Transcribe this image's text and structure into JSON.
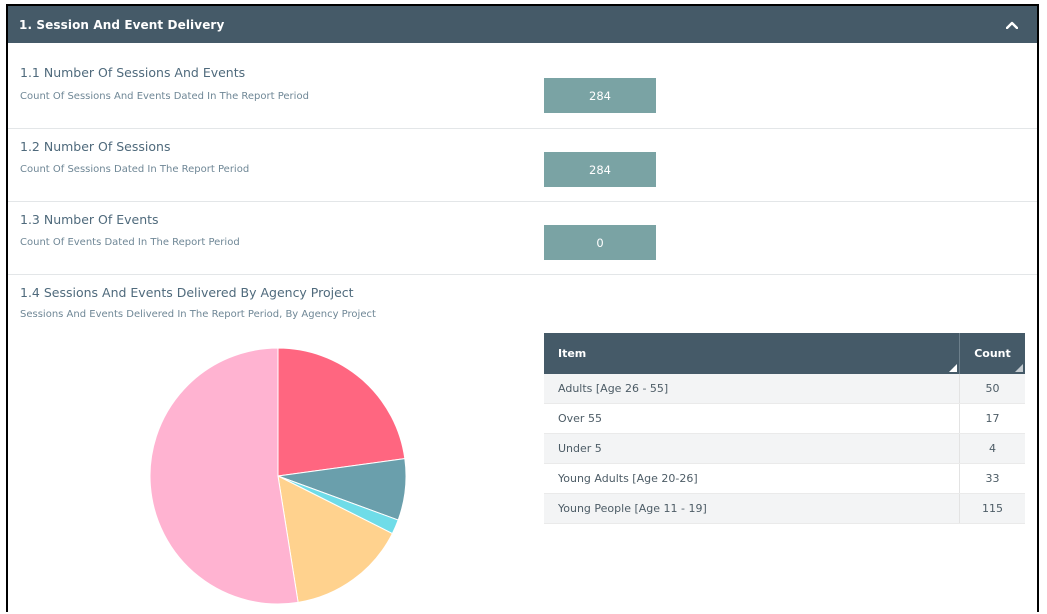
{
  "header": {
    "title": "1. Session And Event Delivery",
    "collapse_icon": "chevron-up-icon"
  },
  "sections": [
    {
      "title": "1.1 Number Of Sessions And Events",
      "subtitle": "Count Of Sessions And Events Dated In The Report Period",
      "value": "284"
    },
    {
      "title": "1.2 Number Of Sessions",
      "subtitle": "Count Of Sessions Dated In The Report Period",
      "value": "284"
    },
    {
      "title": "1.3 Number Of Events",
      "subtitle": "Count Of Events Dated In The Report Period",
      "value": "0"
    }
  ],
  "breakdown": {
    "title": "1.4 Sessions And Events Delivered By Agency Project",
    "subtitle": "Sessions And Events Delivered In The Report Period, By Agency Project",
    "table": {
      "headers": [
        "Item",
        "Count"
      ],
      "rows": [
        {
          "item": "Adults [Age 26 - 55]",
          "count": "50"
        },
        {
          "item": "Over 55",
          "count": "17"
        },
        {
          "item": "Under 5",
          "count": "4"
        },
        {
          "item": "Young Adults [Age 20-26]",
          "count": "33"
        },
        {
          "item": "Young People [Age 11 - 19]",
          "count": "115"
        }
      ]
    }
  },
  "chart_data": {
    "type": "pie",
    "categories": [
      "Adults [Age 26 - 55]",
      "Over 55",
      "Under 5",
      "Young Adults [Age 20-26]",
      "Young People [Age 11 - 19]"
    ],
    "values": [
      50,
      17,
      4,
      33,
      115
    ],
    "colors": [
      "#ff6680",
      "#6a9fac",
      "#6fdce8",
      "#ffd28e",
      "#ffb3d1"
    ]
  }
}
